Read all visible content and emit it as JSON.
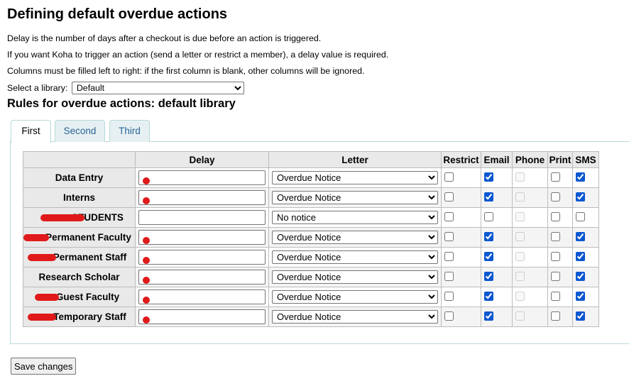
{
  "page_title": "Defining default overdue actions",
  "info_lines": [
    "Delay is the number of days after a checkout is due before an action is triggered.",
    "If you want Koha to trigger an action (send a letter or restrict a member), a delay value is required.",
    "Columns must be filled left to right: if the first column is blank, other columns will be ignored."
  ],
  "library_select": {
    "label": "Select a library:",
    "value": "Default"
  },
  "section_title": "Rules for overdue actions: default library",
  "tabs": [
    "First",
    "Second",
    "Third"
  ],
  "table": {
    "headers": [
      "",
      "Delay",
      "Letter",
      "Restrict",
      "Email",
      "Phone",
      "Print",
      "SMS"
    ],
    "rows": [
      {
        "category": "Data Entry",
        "redacted_prefix": false,
        "delay_redacted": true,
        "letter": "Overdue Notice",
        "restrict": false,
        "email": true,
        "phone": false,
        "print": false,
        "sms": true
      },
      {
        "category": "Interns",
        "redacted_prefix": false,
        "delay_redacted": true,
        "letter": "Overdue Notice",
        "restrict": false,
        "email": true,
        "phone": false,
        "print": false,
        "sms": true
      },
      {
        "category": "STUDENTS",
        "redacted_prefix": true,
        "delay_redacted": false,
        "letter": "No notice",
        "restrict": false,
        "email": false,
        "phone": false,
        "print": false,
        "sms": false
      },
      {
        "category": "Permanent Faculty",
        "redacted_prefix": true,
        "delay_redacted": true,
        "letter": "Overdue Notice",
        "restrict": false,
        "email": true,
        "phone": false,
        "print": false,
        "sms": true
      },
      {
        "category": "Permanent Staff",
        "redacted_prefix": true,
        "delay_redacted": true,
        "letter": "Overdue Notice",
        "restrict": false,
        "email": true,
        "phone": false,
        "print": false,
        "sms": true
      },
      {
        "category": "Research Scholar",
        "redacted_prefix": false,
        "delay_redacted": true,
        "letter": "Overdue Notice",
        "restrict": false,
        "email": true,
        "phone": false,
        "print": false,
        "sms": true
      },
      {
        "category": "Guest Faculty",
        "redacted_prefix": true,
        "delay_redacted": true,
        "letter": "Overdue Notice",
        "restrict": false,
        "email": true,
        "phone": false,
        "print": false,
        "sms": true
      },
      {
        "category": "Temporary Staff",
        "redacted_prefix": true,
        "delay_redacted": true,
        "letter": "Overdue Notice",
        "restrict": false,
        "email": true,
        "phone": false,
        "print": false,
        "sms": true
      }
    ]
  },
  "save_button": "Save changes",
  "colors": {
    "tab_border": "#b9d8d9",
    "tab_inactive_bg": "#e6f0f2",
    "tab_link": "#2a6496",
    "redaction": "#e01a1a",
    "header_bg": "#e9e9e9"
  }
}
